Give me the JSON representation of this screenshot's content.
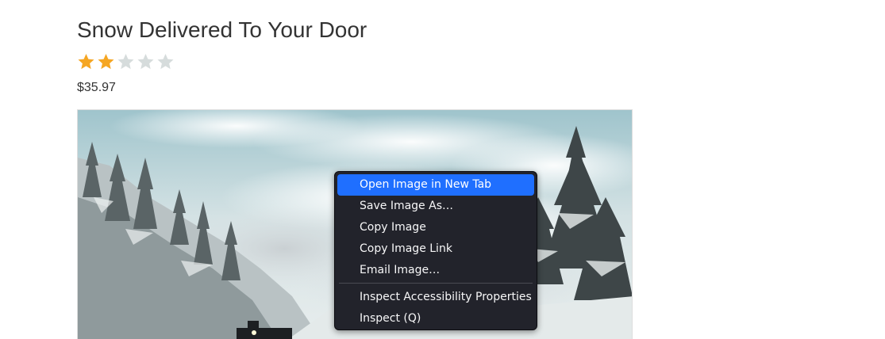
{
  "product": {
    "title": "Snow Delivered To Your Door",
    "rating": 2,
    "rating_max": 5,
    "price": "$35.97"
  },
  "colors": {
    "star_filled": "#f5a623",
    "star_empty": "#d6dcdc",
    "menu_background": "#22232b",
    "menu_highlight": "#1f6fff"
  },
  "icons": {
    "star": "star-icon"
  },
  "context_menu": {
    "items": [
      {
        "label": "Open Image in New Tab",
        "highlighted": true
      },
      {
        "label": "Save Image As…",
        "highlighted": false
      },
      {
        "label": "Copy Image",
        "highlighted": false
      },
      {
        "label": "Copy Image Link",
        "highlighted": false
      },
      {
        "label": "Email Image…",
        "highlighted": false
      }
    ],
    "items_after_separator": [
      {
        "label": "Inspect Accessibility Properties"
      },
      {
        "label": "Inspect (Q)"
      }
    ]
  }
}
